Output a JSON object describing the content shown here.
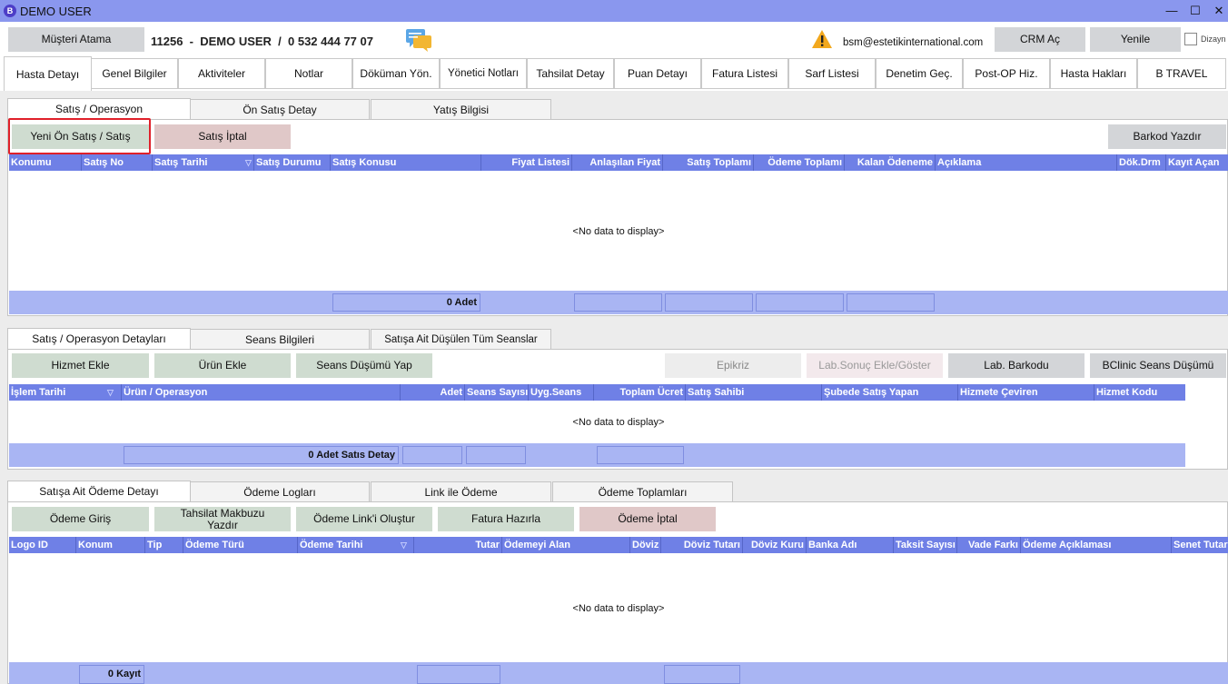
{
  "window": {
    "app_icon": "B",
    "title": "DEMO USER",
    "minimize": "—",
    "maximize": "☐",
    "close": "✕"
  },
  "header": {
    "assign_button": "Müşteri Atama",
    "patient_line": "11256  -  DEMO USER  /  0 532 444 77 07",
    "email": "bsm@estetikinternational.com",
    "crm_button": "CRM Aç",
    "refresh_button": "Yenile",
    "design_label": "Dizayn"
  },
  "main_tabs": [
    "Hasta Detayı",
    "Genel Bilgiler",
    "Aktiviteler",
    "Notlar",
    "Döküman Yön.",
    "Yönetici Notları",
    "Tahsilat Detay",
    "Puan Detayı",
    "Fatura Listesi",
    "Sarf Listesi",
    "Denetim Geç.",
    "Post-OP Hiz.",
    "Hasta Hakları",
    "B TRAVEL"
  ],
  "sales": {
    "tabs": [
      "Satış / Operasyon",
      "Ön Satış Detay",
      "Yatış Bilgisi"
    ],
    "new_button": "Yeni Ön Satış / Satış",
    "cancel_button": "Satış İptal",
    "barcode_button": "Barkod Yazdır",
    "columns": [
      "Konumu",
      "Satış No",
      "Satış Tarihi",
      "Satış Durumu",
      "Satış Konusu",
      "Fiyat Listesi",
      "Anlaşılan Fiyat",
      "Satış Toplamı",
      "Ödeme Toplamı",
      "Kalan Ödeneme",
      "Açıklama",
      "Dök.Drm",
      "Kayıt Açan"
    ],
    "empty": "<No data to display>",
    "footer_count": "0 Adet"
  },
  "details": {
    "tabs": [
      "Satış / Operasyon Detayları",
      "Seans Bilgileri",
      "Satışa Ait Düşülen Tüm Seanslar"
    ],
    "buttons": {
      "add_service": "Hizmet Ekle",
      "add_product": "Ürün Ekle",
      "session_deduct": "Seans Düşümü Yap",
      "epikriz": "Epikriz",
      "lab_result": "Lab.Sonuç Ekle/Göster",
      "lab_barcode": "Lab. Barkodu",
      "bclinic": "BClinic Seans Düşümü"
    },
    "columns": [
      "İşlem Tarihi",
      "Ürün / Operasyon",
      "Adet",
      "Seans Sayısı",
      "Uyg.Seans",
      "Toplam Ücret",
      "Satış Sahibi",
      "Şubede Satış Yapan",
      "Hizmete Çeviren",
      "Hizmet Kodu"
    ],
    "empty": "<No data to display>",
    "footer_count": "0 Adet Satıs Detay"
  },
  "payments": {
    "tabs": [
      "Satışa Ait Ödeme Detayı",
      "Ödeme Logları",
      "Link ile Ödeme",
      "Ödeme Toplamları"
    ],
    "buttons": {
      "payment_entry": "Ödeme Giriş",
      "print_receipt": "Tahsilat Makbuzu Yazdır",
      "create_link": "Ödeme Link'i Oluştur",
      "invoice_ready": "Fatura Hazırla",
      "payment_cancel": "Ödeme İptal"
    },
    "columns": [
      "Logo ID",
      "Konum",
      "Tip",
      "Ödeme Türü",
      "Ödeme Tarihi",
      "Tutar",
      "Ödemeyi Alan",
      "Döviz",
      "Döviz Tutarı",
      "Döviz Kuru",
      "Banka Adı",
      "Taksit Sayısı",
      "Vade Farkı",
      "Ödeme Açıklaması",
      "Senet Tutarı"
    ],
    "empty": "<No data to display>",
    "footer_count": "0 Kayıt"
  },
  "colors": {
    "titlebar": "#8a97ee",
    "grid_header": "#6f80e6",
    "grid_footer": "#a9b5f3",
    "highlight": "#e0202a"
  }
}
